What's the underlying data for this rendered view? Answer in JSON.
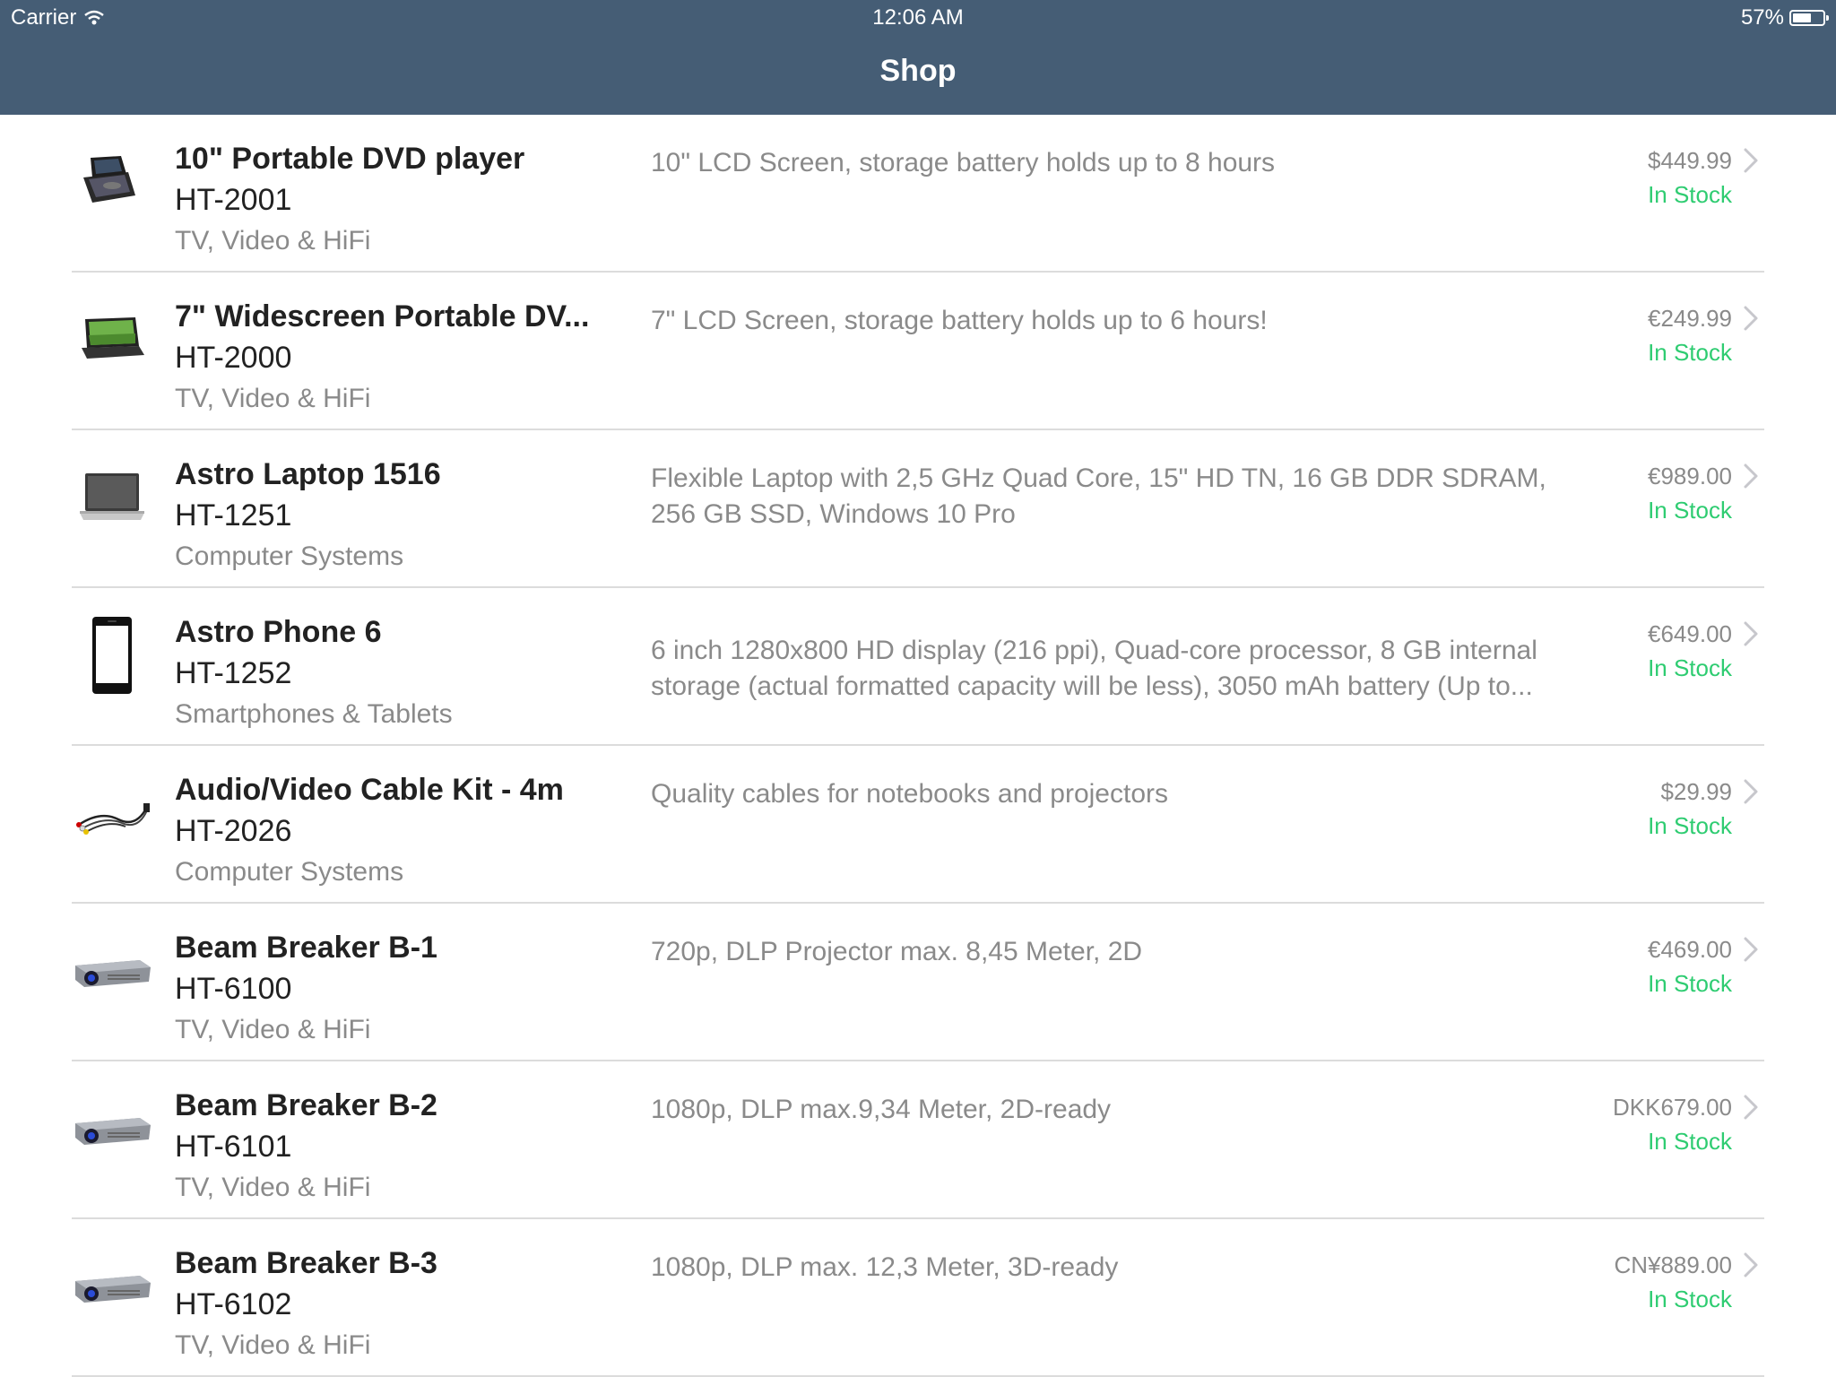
{
  "status_bar": {
    "carrier": "Carrier",
    "time": "12:06 AM",
    "battery": "57%"
  },
  "navbar": {
    "title": "Shop"
  },
  "colors": {
    "navbar": "#455d75",
    "in_stock": "#2ecc71",
    "secondary_text": "#8a8a8a"
  },
  "products": [
    {
      "name": "10\" Portable DVD player",
      "sku": "HT-2001",
      "category": "TV, Video & HiFi",
      "description": "10\" LCD Screen, storage battery holds up to 8 hours",
      "price": "$449.99",
      "stock": "In Stock",
      "thumb_icon": "portable-dvd-player-icon"
    },
    {
      "name": "7\" Widescreen Portable DV...",
      "sku": "HT-2000",
      "category": "TV, Video & HiFi",
      "description": "7\" LCD Screen, storage battery holds up to 6 hours!",
      "price": "€249.99",
      "stock": "In Stock",
      "thumb_icon": "widescreen-dvd-player-icon"
    },
    {
      "name": "Astro Laptop 1516",
      "sku": "HT-1251",
      "category": "Computer Systems",
      "description": "Flexible Laptop with 2,5 GHz Quad Core, 15\" HD TN, 16 GB DDR SDRAM, 256 GB SSD, Windows 10 Pro",
      "price": "€989.00",
      "stock": "In Stock",
      "thumb_icon": "laptop-icon"
    },
    {
      "name": "Astro Phone 6",
      "sku": "HT-1252",
      "category": "Smartphones & Tablets",
      "description": "6 inch 1280x800 HD display (216 ppi), Quad-core processor, 8 GB internal storage (actual formatted capacity will be less), 3050 mAh battery (Up to...",
      "price": "€649.00",
      "stock": "In Stock",
      "thumb_icon": "smartphone-icon"
    },
    {
      "name": "Audio/Video Cable Kit - 4m",
      "sku": "HT-2026",
      "category": "Computer Systems",
      "description": "Quality cables for notebooks and projectors",
      "price": "$29.99",
      "stock": "In Stock",
      "thumb_icon": "cable-kit-icon"
    },
    {
      "name": "Beam Breaker B-1",
      "sku": "HT-6100",
      "category": "TV, Video & HiFi",
      "description": "720p, DLP Projector max. 8,45 Meter, 2D",
      "price": "€469.00",
      "stock": "In Stock",
      "thumb_icon": "projector-icon"
    },
    {
      "name": "Beam Breaker B-2",
      "sku": "HT-6101",
      "category": "TV, Video & HiFi",
      "description": "1080p, DLP max.9,34 Meter, 2D-ready",
      "price": "DKK679.00",
      "stock": "In Stock",
      "thumb_icon": "projector-icon"
    },
    {
      "name": "Beam Breaker B-3",
      "sku": "HT-6102",
      "category": "TV, Video & HiFi",
      "description": "1080p, DLP max. 12,3 Meter, 3D-ready",
      "price": "CN¥889.00",
      "stock": "In Stock",
      "thumb_icon": "projector-icon"
    }
  ]
}
